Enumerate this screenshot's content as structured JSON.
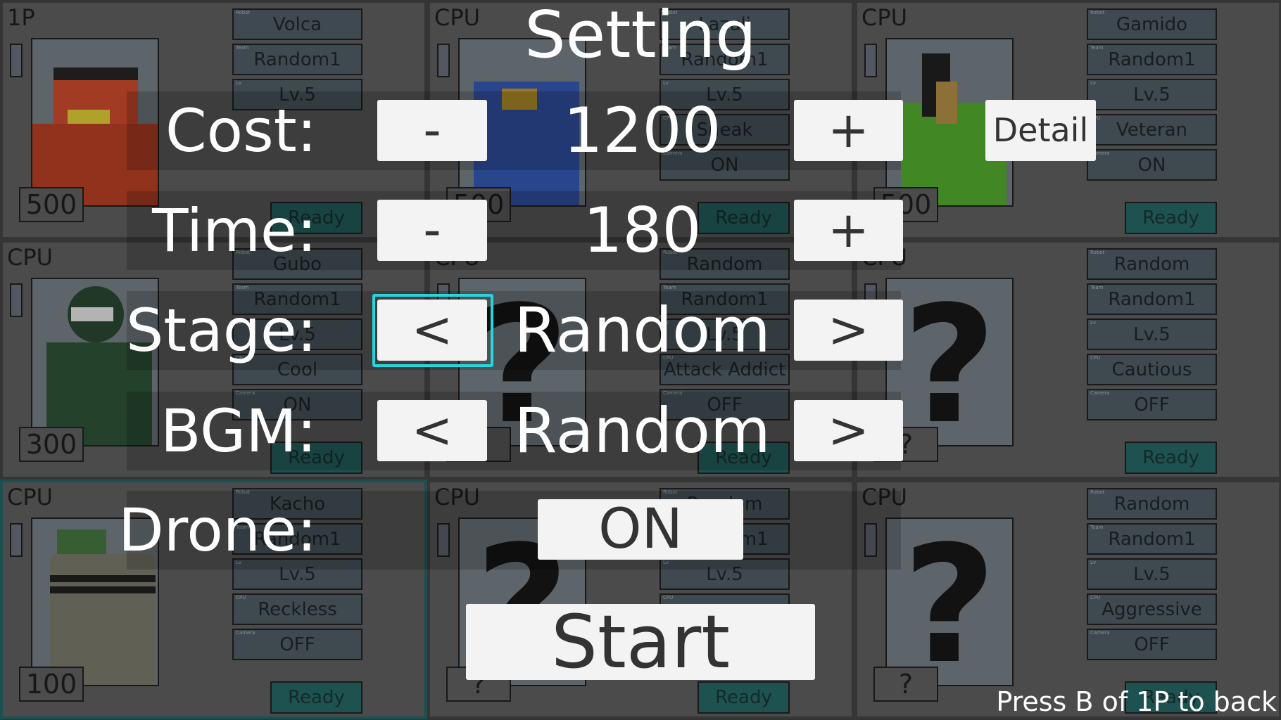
{
  "settings": {
    "title": "Setting",
    "cost": {
      "label": "Cost:",
      "value": "1200",
      "minus": "-",
      "plus": "+"
    },
    "detail_label": "Detail",
    "time": {
      "label": "Time:",
      "value": "180",
      "minus": "-",
      "plus": "+"
    },
    "stage": {
      "label": "Stage:",
      "value": "Random",
      "prev": "<",
      "next": ">"
    },
    "bgm": {
      "label": "BGM:",
      "value": "Random",
      "prev": "<",
      "next": ">"
    },
    "drone": {
      "label": "Drone:",
      "value": "ON"
    },
    "start_label": "Start",
    "hint": "Press B of 1P to back",
    "focus_color": "#25d6dc"
  },
  "field_labels": [
    "Robot",
    "Team",
    "Lv",
    "CPU",
    "Camera"
  ],
  "ready_label": "Ready",
  "panels": [
    {
      "player": "1P",
      "cost": "500",
      "fields": [
        "Volca",
        "Random1",
        "Lv.5"
      ],
      "portrait": "red-robot",
      "color": "#b8442a"
    },
    {
      "player": "CPU",
      "cost": "500",
      "fields": [
        "Lazuli",
        "Random1",
        "Lv.5",
        "Sneak",
        "ON"
      ],
      "portrait": "blue-robot",
      "color": "#2f4fa0"
    },
    {
      "player": "CPU",
      "cost": "500",
      "fields": [
        "Gamido",
        "Random1",
        "Lv.5",
        "Veteran",
        "ON"
      ],
      "portrait": "green-robot",
      "color": "#4a9a2a"
    },
    {
      "player": "CPU",
      "cost": "300",
      "fields": [
        "Gubo",
        "Random1",
        "Lv.5",
        "Cool",
        "ON"
      ],
      "portrait": "darkgreen-robot",
      "color": "#2a4a32"
    },
    {
      "player": "CPU",
      "cost": "?",
      "fields": [
        "Random",
        "Random1",
        "Lv.5",
        "Attack Addict",
        "OFF"
      ],
      "portrait": "question-mark",
      "color": ""
    },
    {
      "player": "CPU",
      "cost": "?",
      "fields": [
        "Random",
        "Random1",
        "Lv.5",
        "Cautious",
        "OFF"
      ],
      "portrait": "question-mark",
      "color": ""
    },
    {
      "player": "CPU",
      "cost": "100",
      "fields": [
        "Kacho",
        "Random1",
        "Lv.5",
        "Reckless",
        "OFF"
      ],
      "portrait": "tower-drone",
      "color": "#6e6e60",
      "selected": true
    },
    {
      "player": "CPU",
      "cost": "?",
      "fields": [
        "Random",
        "Random1",
        "Lv.5",
        "",
        ""
      ],
      "portrait": "question-mark",
      "color": ""
    },
    {
      "player": "CPU",
      "cost": "?",
      "fields": [
        "Random",
        "Random1",
        "Lv.5",
        "Aggressive",
        "OFF"
      ],
      "portrait": "question-mark",
      "color": ""
    }
  ],
  "question_mark": "?"
}
